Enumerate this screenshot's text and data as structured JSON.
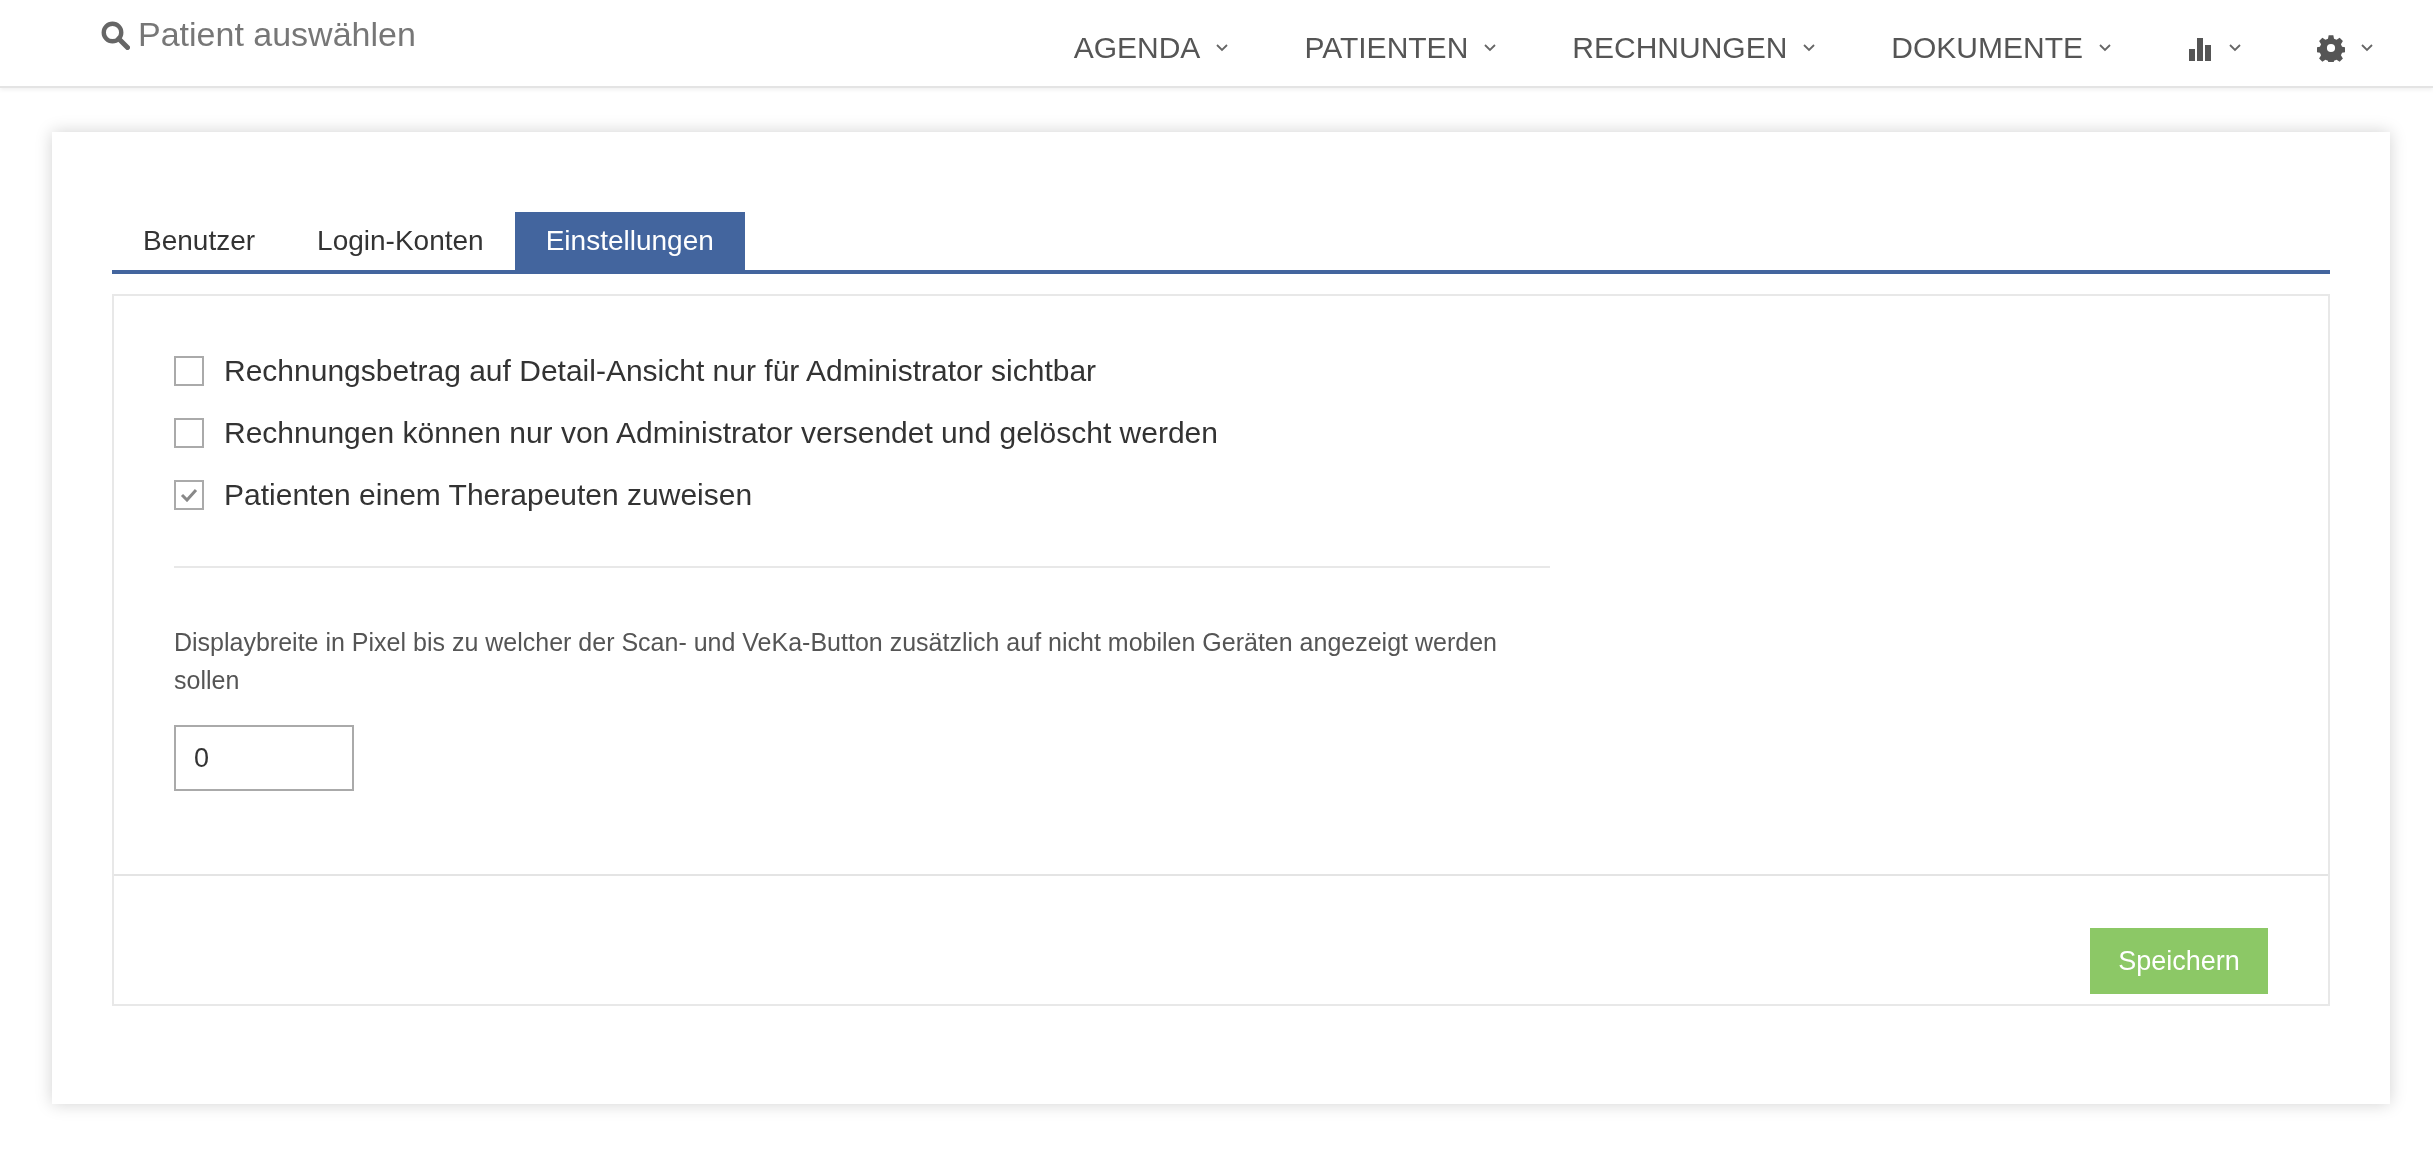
{
  "search": {
    "placeholder": "Patient auswählen"
  },
  "nav": [
    {
      "kind": "text",
      "label": "AGENDA"
    },
    {
      "kind": "text",
      "label": "PATIENTEN"
    },
    {
      "kind": "text",
      "label": "RECHNUNGEN"
    },
    {
      "kind": "text",
      "label": "DOKUMENTE"
    },
    {
      "kind": "chart"
    },
    {
      "kind": "settings"
    }
  ],
  "tabs": [
    {
      "label": "Benutzer",
      "selected": false
    },
    {
      "label": "Login-Konten",
      "selected": false
    },
    {
      "label": "Einstellungen",
      "selected": true
    }
  ],
  "options": [
    {
      "label": "Rechnungsbetrag auf Detail-Ansicht nur für Administrator sichtbar",
      "checked": false
    },
    {
      "label": "Rechnungen können nur von Administrator versendet und gelöscht werden",
      "checked": false
    },
    {
      "label": "Patienten einem Therapeuten zuweisen",
      "checked": true
    }
  ],
  "display_width": {
    "label": "Displaybreite in Pixel bis zu welcher der Scan- und VeKa-Button zusätzlich auf nicht mobilen Geräten angezeigt werden sollen",
    "value": "0"
  },
  "save_button": "Speichern"
}
